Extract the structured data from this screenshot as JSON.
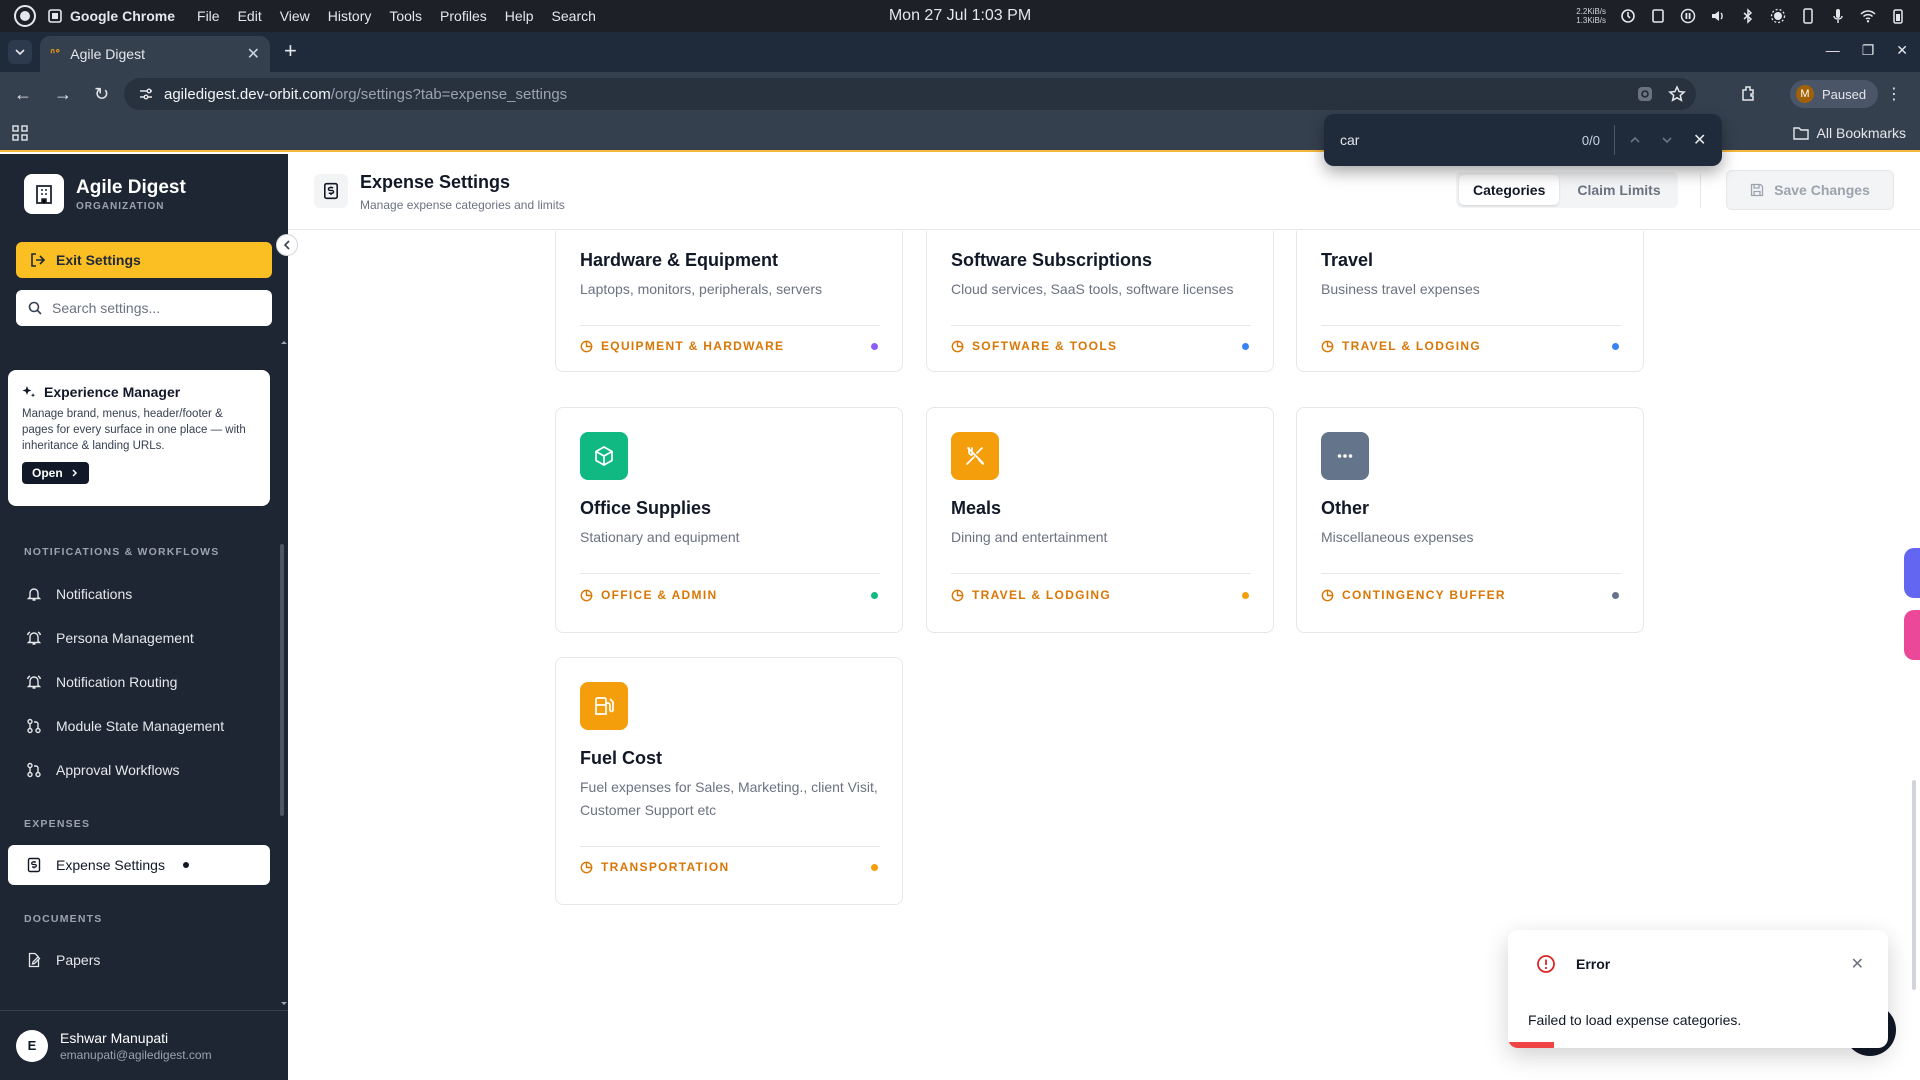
{
  "os": {
    "app_name": "Google Chrome",
    "menus": [
      "File",
      "Edit",
      "View",
      "History",
      "Tools",
      "Profiles",
      "Help",
      "Search"
    ],
    "clock": "Mon 27 Jul  1:03 PM",
    "net_up": "2.2KiB/s",
    "net_down": "1.3KiB/s"
  },
  "browser": {
    "tab_title": "Agile Digest",
    "url_host": "agiledigest.dev-orbit.com",
    "url_path": "/org/settings?tab=expense_settings",
    "profile_initial": "M",
    "profile_status": "Paused",
    "all_bookmarks": "All Bookmarks",
    "find": {
      "query": "car",
      "count": "0/0"
    }
  },
  "sidebar": {
    "org_name": "Agile Digest",
    "org_type": "ORGANIZATION",
    "exit_label": "Exit Settings",
    "search_placeholder": "Search settings...",
    "promo": {
      "title": "Experience Manager",
      "body": "Manage brand, menus, header/footer & pages for every surface in one place — with inheritance & landing URLs.",
      "button": "Open"
    },
    "sections": [
      {
        "title": "NOTIFICATIONS & WORKFLOWS",
        "items": [
          "Notifications",
          "Persona Management",
          "Notification Routing",
          "Module State Management",
          "Approval Workflows"
        ]
      },
      {
        "title": "EXPENSES",
        "items": [
          "Expense Settings"
        ]
      },
      {
        "title": "DOCUMENTS",
        "items": [
          "Papers"
        ]
      }
    ],
    "user": {
      "initial": "E",
      "name": "Eshwar Manupati",
      "email": "emanupati@agiledigest.com"
    }
  },
  "header": {
    "title": "Expense Settings",
    "subtitle": "Manage expense categories and limits",
    "tabs": [
      "Categories",
      "Claim Limits"
    ],
    "active_tab": "Categories",
    "save_label": "Save Changes"
  },
  "categories": [
    {
      "name": "Hardware & Equipment",
      "description": "Laptops, monitors, peripherals, servers",
      "budget_tag": "EQUIPMENT & HARDWARE",
      "dot_color": "#8b5cf6"
    },
    {
      "name": "Software Subscriptions",
      "description": "Cloud services, SaaS tools, software licenses",
      "budget_tag": "SOFTWARE & TOOLS",
      "dot_color": "#3b82f6"
    },
    {
      "name": "Travel",
      "description": "Business travel expenses",
      "budget_tag": "TRAVEL & LODGING",
      "dot_color": "#3b82f6"
    },
    {
      "name": "Office Supplies",
      "description": "Stationary and equipment",
      "budget_tag": "OFFICE & ADMIN",
      "dot_color": "#10b981",
      "icon": "box-icon",
      "icon_color": "#10b981"
    },
    {
      "name": "Meals",
      "description": "Dining and entertainment",
      "budget_tag": "TRAVEL & LODGING",
      "dot_color": "#f59e0b",
      "icon": "utensils-icon",
      "icon_color": "#f59e0b"
    },
    {
      "name": "Other",
      "description": "Miscellaneous expenses",
      "budget_tag": "CONTINGENCY BUFFER",
      "dot_color": "#64748b",
      "icon": "more-horizontal-icon",
      "icon_color": "#64748b"
    },
    {
      "name": "Fuel Cost",
      "description": "Fuel expenses for Sales, Marketing., client Visit, Customer Support etc",
      "budget_tag": "TRANSPORTATION",
      "dot_color": "#f59e0b",
      "icon": "fuel-icon",
      "icon_color": "#f59e0b"
    }
  ],
  "toast": {
    "title": "Error",
    "message": "Failed to load expense categories.",
    "progress": 0.12
  }
}
